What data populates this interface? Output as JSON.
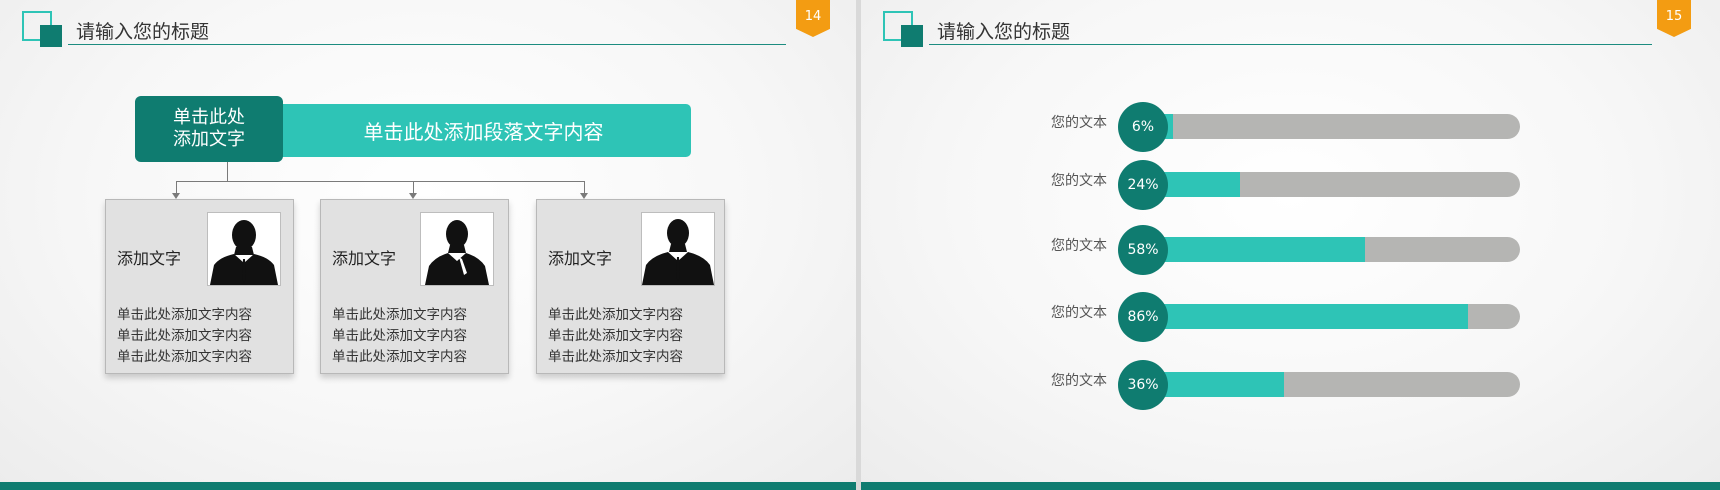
{
  "slides": [
    {
      "page_number": "14",
      "title": "请输入您的标题",
      "header": {
        "title": "单击此处\n添加文字",
        "banner": "单击此处添加段落文字内容"
      },
      "cards": [
        {
          "label": "添加文字",
          "lines": [
            "单击此处添加文字内容",
            "单击此处添加文字内容",
            "单击此处添加文字内容"
          ]
        },
        {
          "label": "添加文字",
          "lines": [
            "单击此处添加文字内容",
            "单击此处添加文字内容",
            "单击此处添加文字内容"
          ]
        },
        {
          "label": "添加文字",
          "lines": [
            "单击此处添加文字内容",
            "单击此处添加文字内容",
            "单击此处添加文字内容"
          ]
        }
      ]
    },
    {
      "page_number": "15",
      "title": "请输入您的标题",
      "bars": [
        {
          "label": "您的文本",
          "value": 6,
          "display": "6%"
        },
        {
          "label": "您的文本",
          "value": 24,
          "display": "24%"
        },
        {
          "label": "您的文本",
          "value": 58,
          "display": "58%"
        },
        {
          "label": "您的文本",
          "value": 86,
          "display": "86%"
        },
        {
          "label": "您的文本",
          "value": 36,
          "display": "36%"
        }
      ]
    }
  ],
  "colors": {
    "accent_dark": "#0f7c70",
    "accent_light": "#2ec4b6",
    "badge": "#f39c12",
    "track": "#b5b5b3"
  },
  "icons": [
    "person-silhouette-icon"
  ]
}
